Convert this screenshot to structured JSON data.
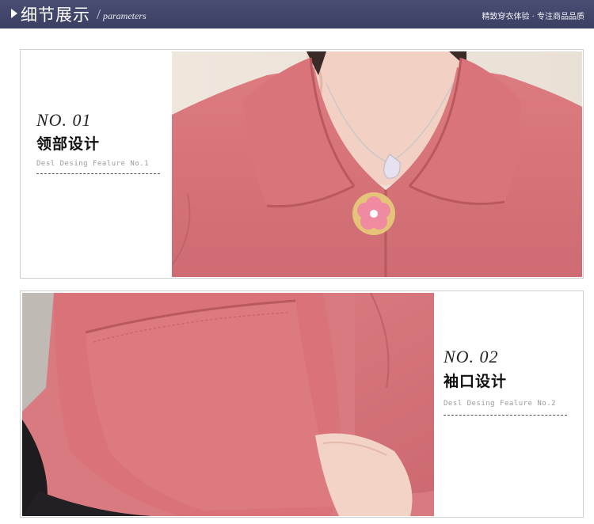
{
  "banner": {
    "title": "细节展示",
    "subtitle": "parameters",
    "slogan": "精致穿衣体验 · 专注商品品质"
  },
  "details": [
    {
      "number": "NO. 01",
      "title": "领部设计",
      "caption": "Desl Desing Fealure No.1"
    },
    {
      "number": "NO. 02",
      "title": "袖口设计",
      "caption": "Desl Desing Fealure No.2"
    }
  ],
  "colors": {
    "banner": "#3f4368",
    "coat_pink": "#d9757a",
    "coat_shadow": "#b85a61",
    "skin": "#f3d2c6"
  }
}
